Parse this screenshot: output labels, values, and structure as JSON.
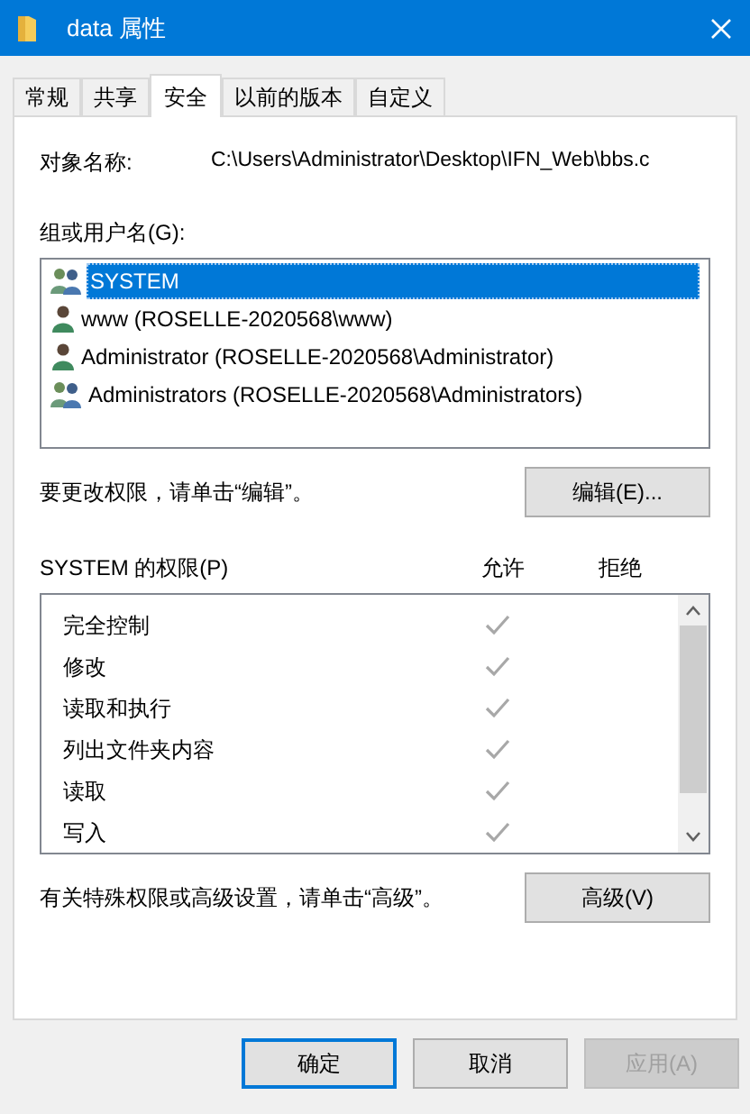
{
  "window": {
    "title": "data 属性"
  },
  "tabs": [
    {
      "label": "常规",
      "selected": false
    },
    {
      "label": "共享",
      "selected": false
    },
    {
      "label": "安全",
      "selected": true
    },
    {
      "label": "以前的版本",
      "selected": false
    },
    {
      "label": "自定义",
      "selected": false
    }
  ],
  "object_name": {
    "label": "对象名称:",
    "value": "C:\\Users\\Administrator\\Desktop\\IFN_Web\\bbs.c"
  },
  "groups": {
    "label": "组或用户名(G):",
    "items": [
      {
        "kind": "group",
        "name": "SYSTEM",
        "selected": true
      },
      {
        "kind": "user",
        "name": "www (ROSELLE-2020568\\www)",
        "selected": false
      },
      {
        "kind": "user",
        "name": "Administrator (ROSELLE-2020568\\Administrator)",
        "selected": false
      },
      {
        "kind": "group",
        "name": "Administrators (ROSELLE-2020568\\Administrators)",
        "selected": false
      }
    ]
  },
  "edit_hint": "要更改权限，请单击“编辑”。",
  "edit_button": "编辑(E)...",
  "permissions": {
    "label": "SYSTEM 的权限(P)",
    "allow_header": "允许",
    "deny_header": "拒绝",
    "rows": [
      {
        "name": "完全控制",
        "allow": true,
        "deny": false
      },
      {
        "name": "修改",
        "allow": true,
        "deny": false
      },
      {
        "name": "读取和执行",
        "allow": true,
        "deny": false
      },
      {
        "name": "列出文件夹内容",
        "allow": true,
        "deny": false
      },
      {
        "name": "读取",
        "allow": true,
        "deny": false
      },
      {
        "name": "写入",
        "allow": true,
        "deny": false
      }
    ]
  },
  "advanced_hint": "有关特殊权限或高级设置，请单击“高级”。",
  "advanced_button": "高级(V)",
  "buttons": [
    {
      "label": "确定",
      "kind": "default",
      "disabled": false
    },
    {
      "label": "取消",
      "kind": "normal",
      "disabled": false
    },
    {
      "label": "应用(A)",
      "kind": "normal",
      "disabled": true
    }
  ]
}
